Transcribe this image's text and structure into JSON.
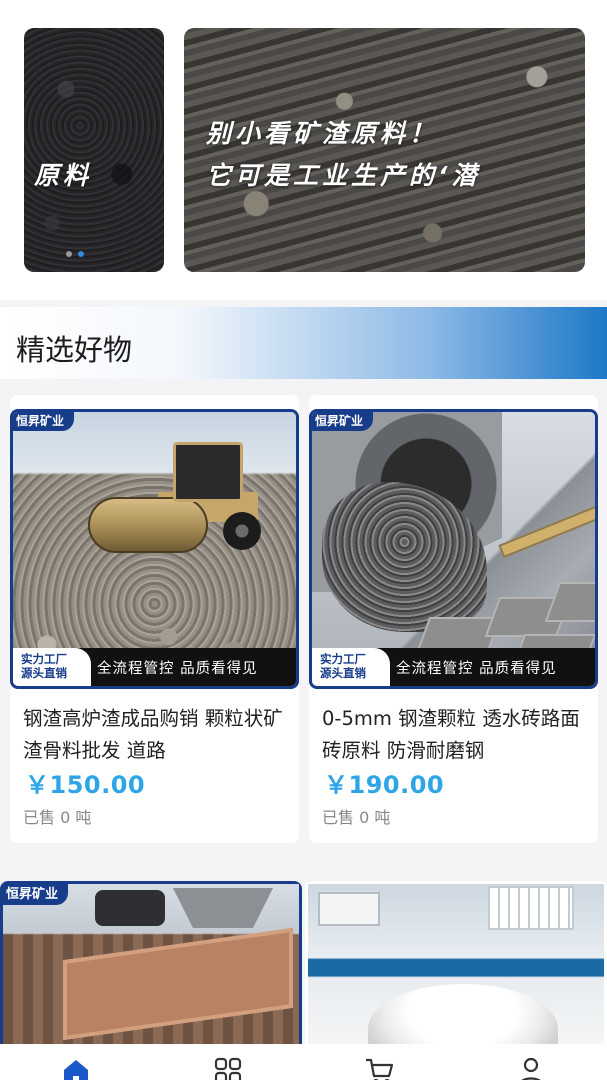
{
  "banner": {
    "prev_slide_text": "原料",
    "main_slide_line1": "别小看矿渣原料！",
    "main_slide_line2": "它可是工业生产的‘潜",
    "dot_count": 2,
    "active_dot": 2
  },
  "section": {
    "title": "精选好物"
  },
  "products": [
    {
      "brand_tag": "恒昇矿业",
      "promo_badge_line1": "实力工厂",
      "promo_badge_line2": "源头直销",
      "promo_text": "全流程管控 品质看得见",
      "title": "钢渣高炉渣成品购销 颗粒状矿渣骨料批发 道路",
      "price": "￥150.00",
      "sold": "已售 0 吨",
      "image_icon": "road-roller-image"
    },
    {
      "brand_tag": "恒昇矿业",
      "promo_badge_line1": "实力工厂",
      "promo_badge_line2": "源头直销",
      "promo_text": "全流程管控 品质看得见",
      "title": "0-5mm 钢渣颗粒 透水砖路面砖原料 防滑耐磨钢",
      "price": "￥190.00",
      "sold": "已售 0 吨",
      "image_icon": "slag-chute-image"
    },
    {
      "brand_tag": "恒昇矿业",
      "image_icon": "vibrating-screen-image"
    },
    {
      "image_icon": "lab-powder-image"
    }
  ],
  "tabbar": {
    "items": [
      {
        "icon": "home-icon",
        "active": true
      },
      {
        "icon": "category-icon",
        "active": false
      },
      {
        "icon": "cart-icon",
        "active": false
      },
      {
        "icon": "user-icon",
        "active": false
      }
    ],
    "active_color": "#1a57c9",
    "inactive_color": "#333333"
  },
  "colors": {
    "brand_navy": "#173c8a",
    "price_blue": "#2da5e6",
    "header_gradient_end": "#1e78c8"
  }
}
